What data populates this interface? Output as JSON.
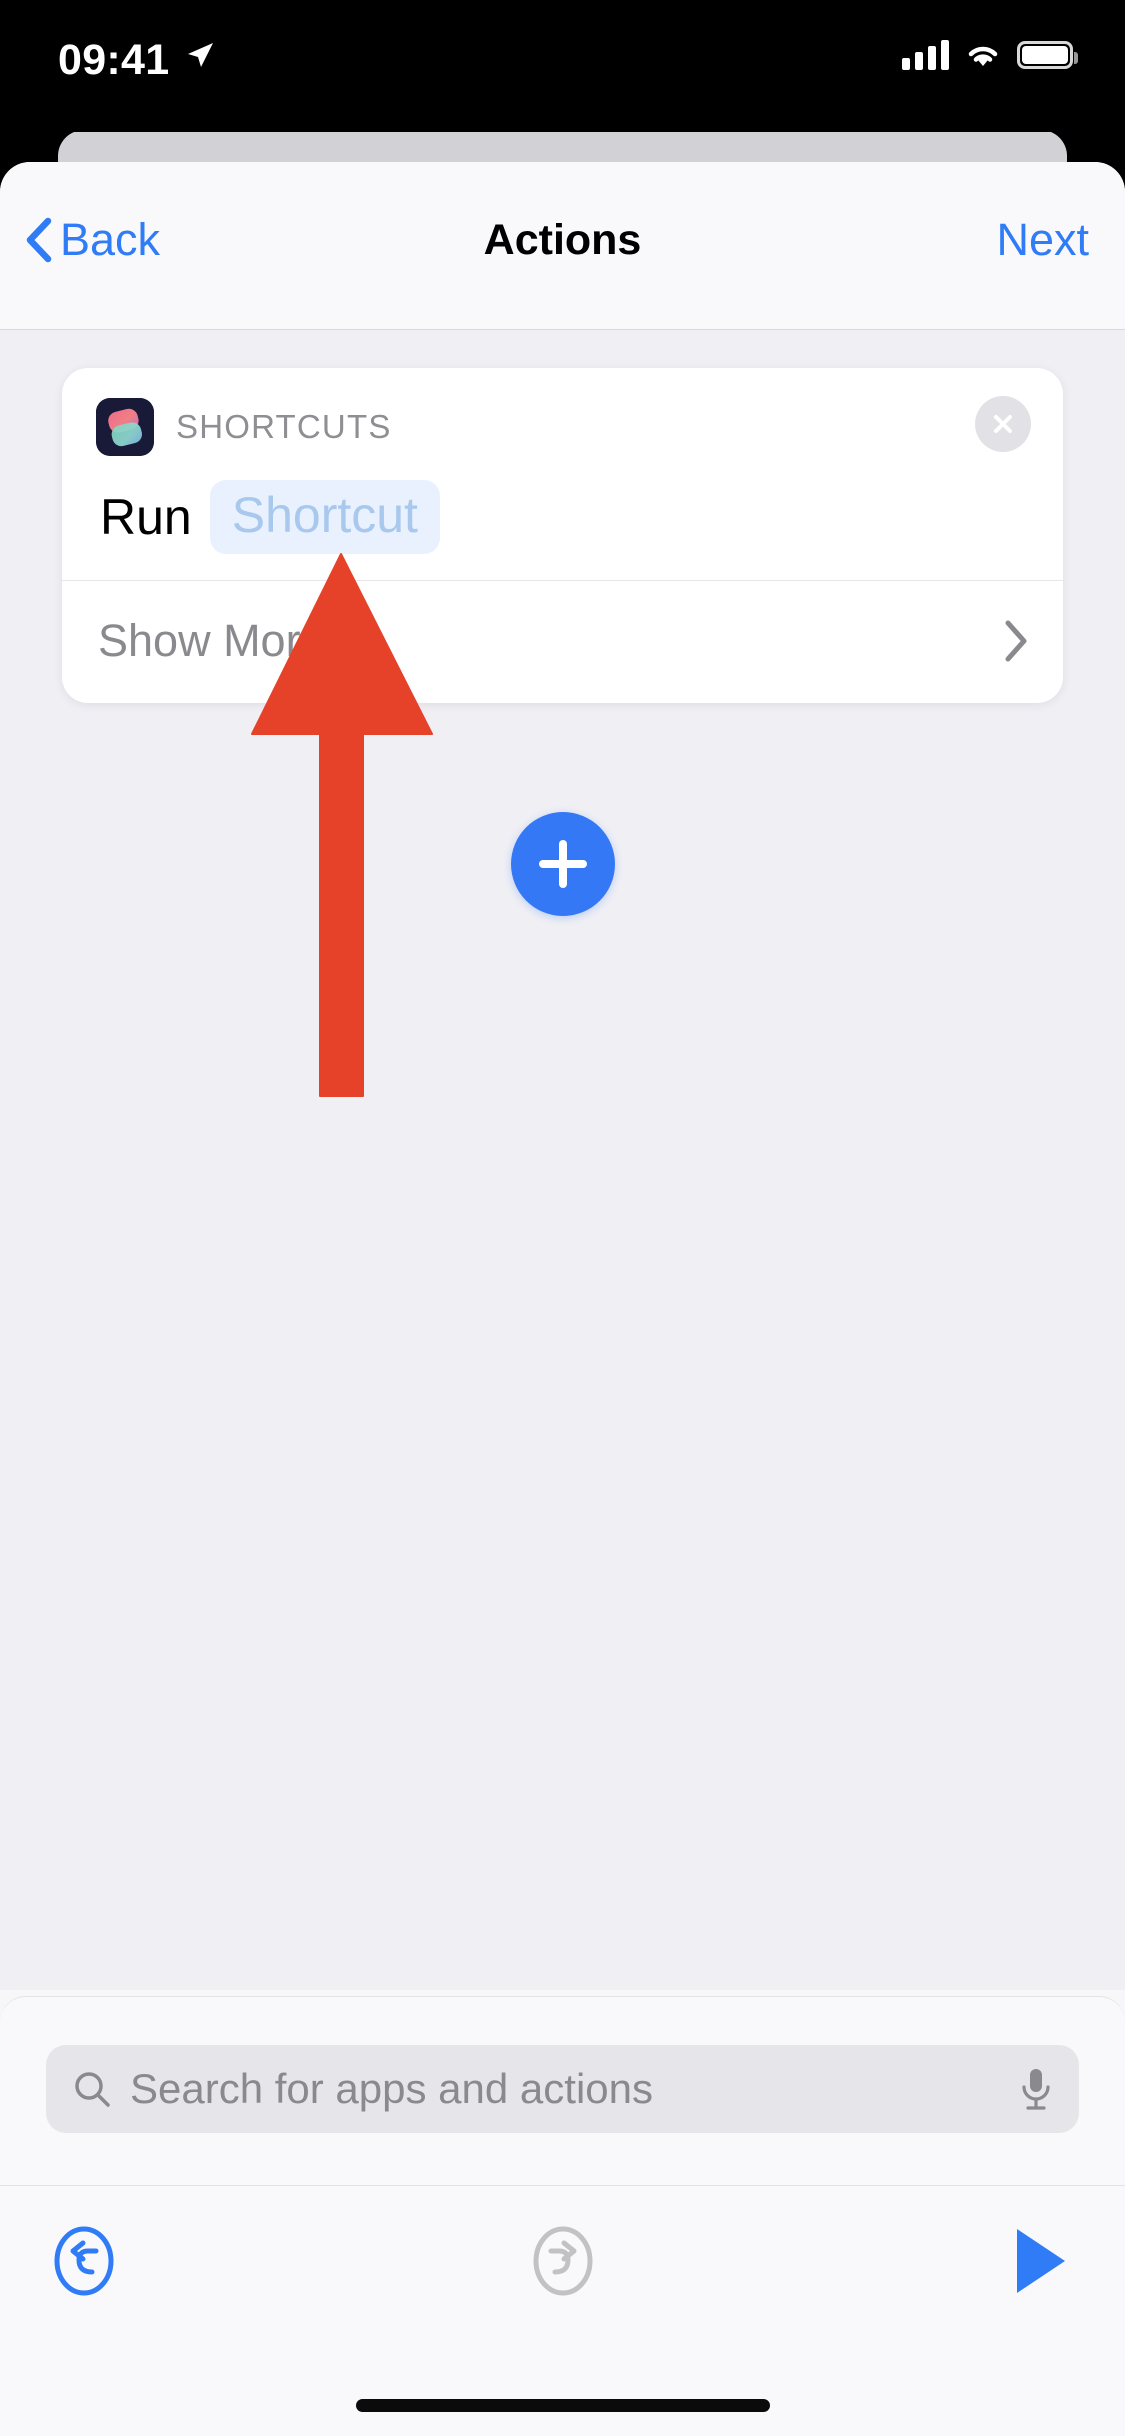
{
  "status_bar": {
    "time": "09:41",
    "location_icon": "location-arrow-icon",
    "signal_icon": "cellular-signal-icon",
    "wifi_icon": "wifi-icon",
    "battery_icon": "battery-full-icon"
  },
  "navbar": {
    "back_label": "Back",
    "back_icon": "chevron-left-icon",
    "title": "Actions",
    "next_label": "Next"
  },
  "action_card": {
    "app_icon": "shortcuts-app-icon",
    "app_name": "SHORTCUTS",
    "close_icon": "close-circle-icon",
    "action_verb": "Run",
    "action_parameter": "Shortcut",
    "show_more_label": "Show More",
    "disclosure_icon": "chevron-right-icon"
  },
  "add_action": {
    "icon": "plus-icon",
    "label": "+"
  },
  "search": {
    "placeholder": "Search for apps and actions",
    "value": "",
    "search_icon": "search-icon",
    "mic_icon": "microphone-icon"
  },
  "toolbar": {
    "undo_icon": "undo-icon",
    "redo_icon": "redo-icon",
    "play_icon": "play-icon"
  },
  "annotation": {
    "arrow_icon": "red-up-arrow-annotation",
    "color": "#e6422a"
  },
  "colors": {
    "accent_blue": "#2f7cf6",
    "add_button_blue": "#3478f6",
    "token_text": "#a8c8ee",
    "token_background": "#e8f1fd",
    "content_background": "#efeff4",
    "sheet_background": "#f9f9fb",
    "secondary_text": "#8a8a8e"
  },
  "home_indicator": "home-indicator"
}
